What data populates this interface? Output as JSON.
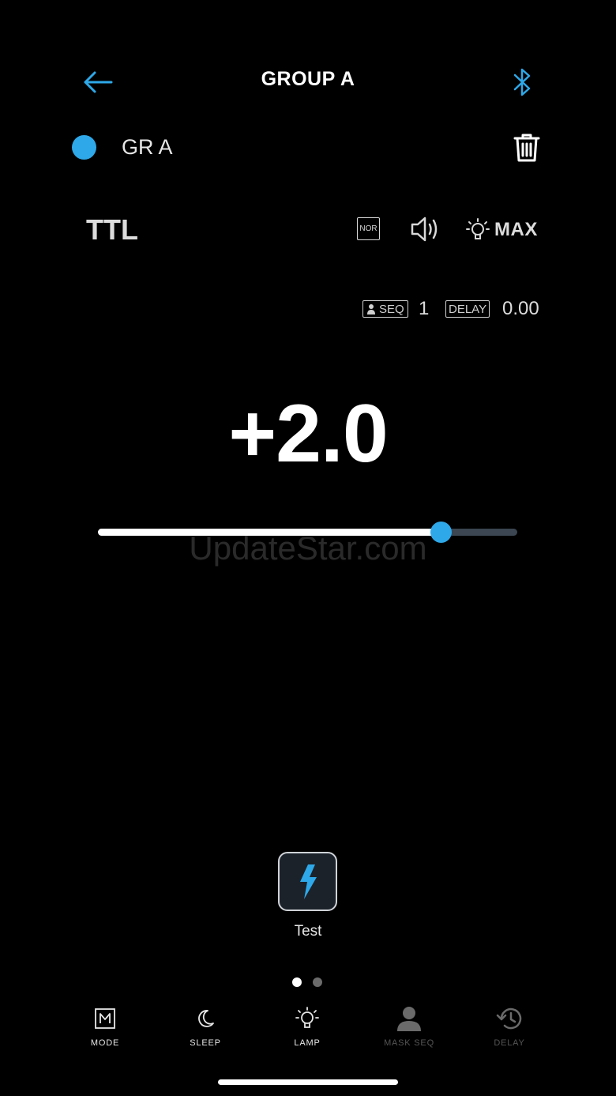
{
  "colors": {
    "accent": "#2ea8e8",
    "background": "#000000"
  },
  "header": {
    "title": "GROUP A",
    "back_icon": "arrow-left-icon",
    "bluetooth_icon": "bluetooth-icon"
  },
  "group": {
    "name": "GR A",
    "color": "#2ea8e8",
    "delete_icon": "trash-icon"
  },
  "mode": {
    "label": "TTL",
    "nor_label": "NOR",
    "sound_icon": "speaker-icon",
    "lamp_icon": "lamp-icon",
    "lamp_value": "MAX"
  },
  "sequence": {
    "seq_label": "SEQ",
    "seq_value": "1",
    "delay_label": "DELAY",
    "delay_value": "0.00"
  },
  "power": {
    "value": "+2.0",
    "slider_fraction": 0.817
  },
  "watermark": "UpdateStar.com",
  "test": {
    "label": "Test",
    "icon": "lightning-icon"
  },
  "pager": {
    "count": 2,
    "active": 0
  },
  "tabs": [
    {
      "label": "MODE",
      "icon": "mode-m-icon",
      "enabled": true
    },
    {
      "label": "SLEEP",
      "icon": "moon-icon",
      "enabled": true
    },
    {
      "label": "LAMP",
      "icon": "lamp-icon",
      "enabled": true
    },
    {
      "label": "MASK SEQ",
      "icon": "person-icon",
      "enabled": false
    },
    {
      "label": "DELAY",
      "icon": "history-icon",
      "enabled": false
    }
  ]
}
